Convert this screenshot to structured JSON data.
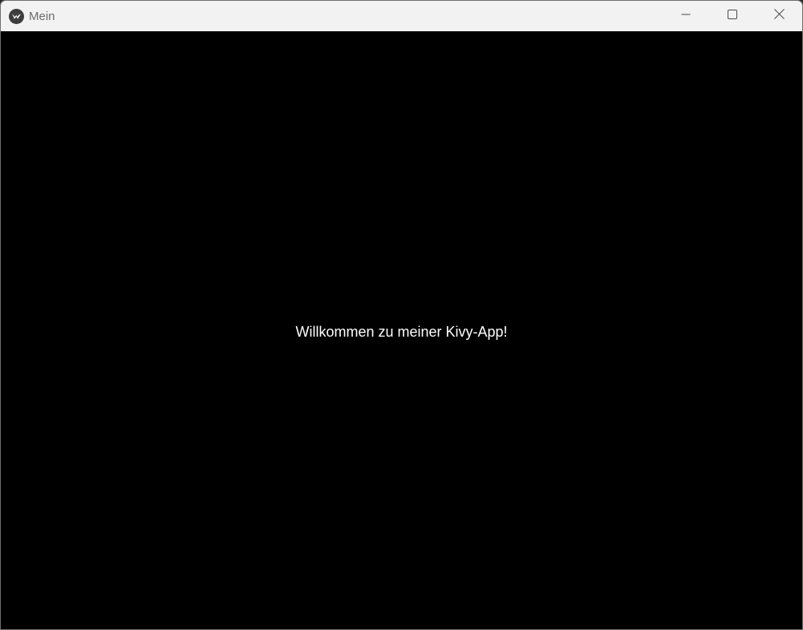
{
  "window": {
    "title": "Mein",
    "icon": "kivy-logo-icon",
    "controls": {
      "minimize": "minimize-icon",
      "maximize": "maximize-icon",
      "close": "close-icon"
    }
  },
  "content": {
    "welcome_text": "Willkommen zu meiner Kivy-App!"
  },
  "colors": {
    "titlebar_bg": "#f2f2f2",
    "title_text": "#6c6c6c",
    "content_bg": "#000000",
    "content_text": "#ffffff"
  }
}
